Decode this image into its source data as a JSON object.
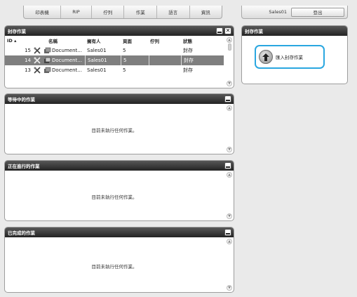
{
  "tabs": [
    "印表機",
    "RIP",
    "佇列",
    "作業",
    "語言",
    "資訊"
  ],
  "user": {
    "name": "Sales01",
    "logout_label": "登出"
  },
  "archived_jobs": {
    "title": "封存作業",
    "columns": {
      "id": "ID ▴",
      "name": "名稱",
      "owner": "擁有人",
      "pages": "頁面",
      "queue": "佇列",
      "status": "狀態"
    },
    "rows": [
      {
        "id": "15",
        "name": "Document...",
        "owner": "Sales01",
        "pages": "5",
        "queue": "",
        "status": "封存"
      },
      {
        "id": "14",
        "name": "Document...",
        "owner": "Sales01",
        "pages": "5",
        "queue": "",
        "status": "封存"
      },
      {
        "id": "13",
        "name": "Document...",
        "owner": "Sales01",
        "pages": "5",
        "queue": "",
        "status": "封存"
      }
    ]
  },
  "waiting_jobs": {
    "title": "等待中的作業",
    "empty": "目前未執行任何作業。"
  },
  "running_jobs": {
    "title": "正在進行的作業",
    "empty": "目前未執行任何作業。"
  },
  "completed_jobs": {
    "title": "已完成的作業",
    "empty": "目前未執行任何作業。"
  },
  "archive_panel": {
    "title": "封存作業",
    "import_label": "匯入封存作業"
  }
}
